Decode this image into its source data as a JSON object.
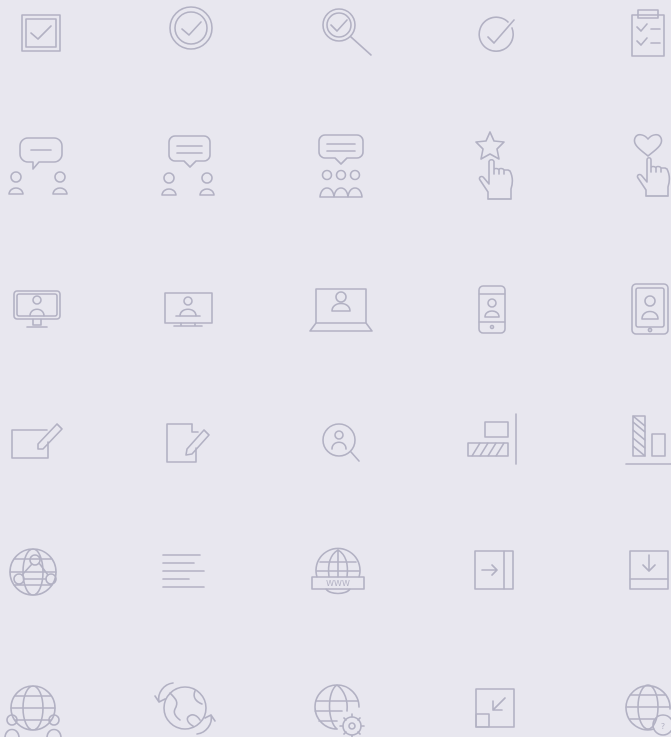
{
  "accent_color": "#b2b1c3",
  "background_color": "#e8e7ef",
  "icons": [
    {
      "name": "checkbox-checked-icon"
    },
    {
      "name": "check-circle-icon"
    },
    {
      "name": "magnify-check-icon"
    },
    {
      "name": "check-thin-icon"
    },
    {
      "name": "clipboard-checklist-icon"
    },
    {
      "name": "chat-two-people-icon"
    },
    {
      "name": "meeting-discussion-icon"
    },
    {
      "name": "group-discussion-icon"
    },
    {
      "name": "hand-star-icon"
    },
    {
      "name": "hand-heart-icon"
    },
    {
      "name": "desktop-user-icon"
    },
    {
      "name": "monitor-user-icon"
    },
    {
      "name": "laptop-user-icon"
    },
    {
      "name": "smartphone-user-icon"
    },
    {
      "name": "tablet-user-icon"
    },
    {
      "name": "edit-box-icon"
    },
    {
      "name": "document-edit-icon"
    },
    {
      "name": "user-search-icon"
    },
    {
      "name": "align-right-icon"
    },
    {
      "name": "bar-columns-icon"
    },
    {
      "name": "globe-network-icon"
    },
    {
      "name": "text-lines-icon"
    },
    {
      "name": "globe-www-icon"
    },
    {
      "name": "login-arrow-icon"
    },
    {
      "name": "download-box-icon"
    },
    {
      "name": "globe-users-icon"
    },
    {
      "name": "globe-refresh-icon"
    },
    {
      "name": "globe-settings-icon"
    },
    {
      "name": "minimize-arrow-icon"
    },
    {
      "name": "globe-help-icon"
    }
  ],
  "globe_www_label": "WWW",
  "globe_help_label": "?"
}
